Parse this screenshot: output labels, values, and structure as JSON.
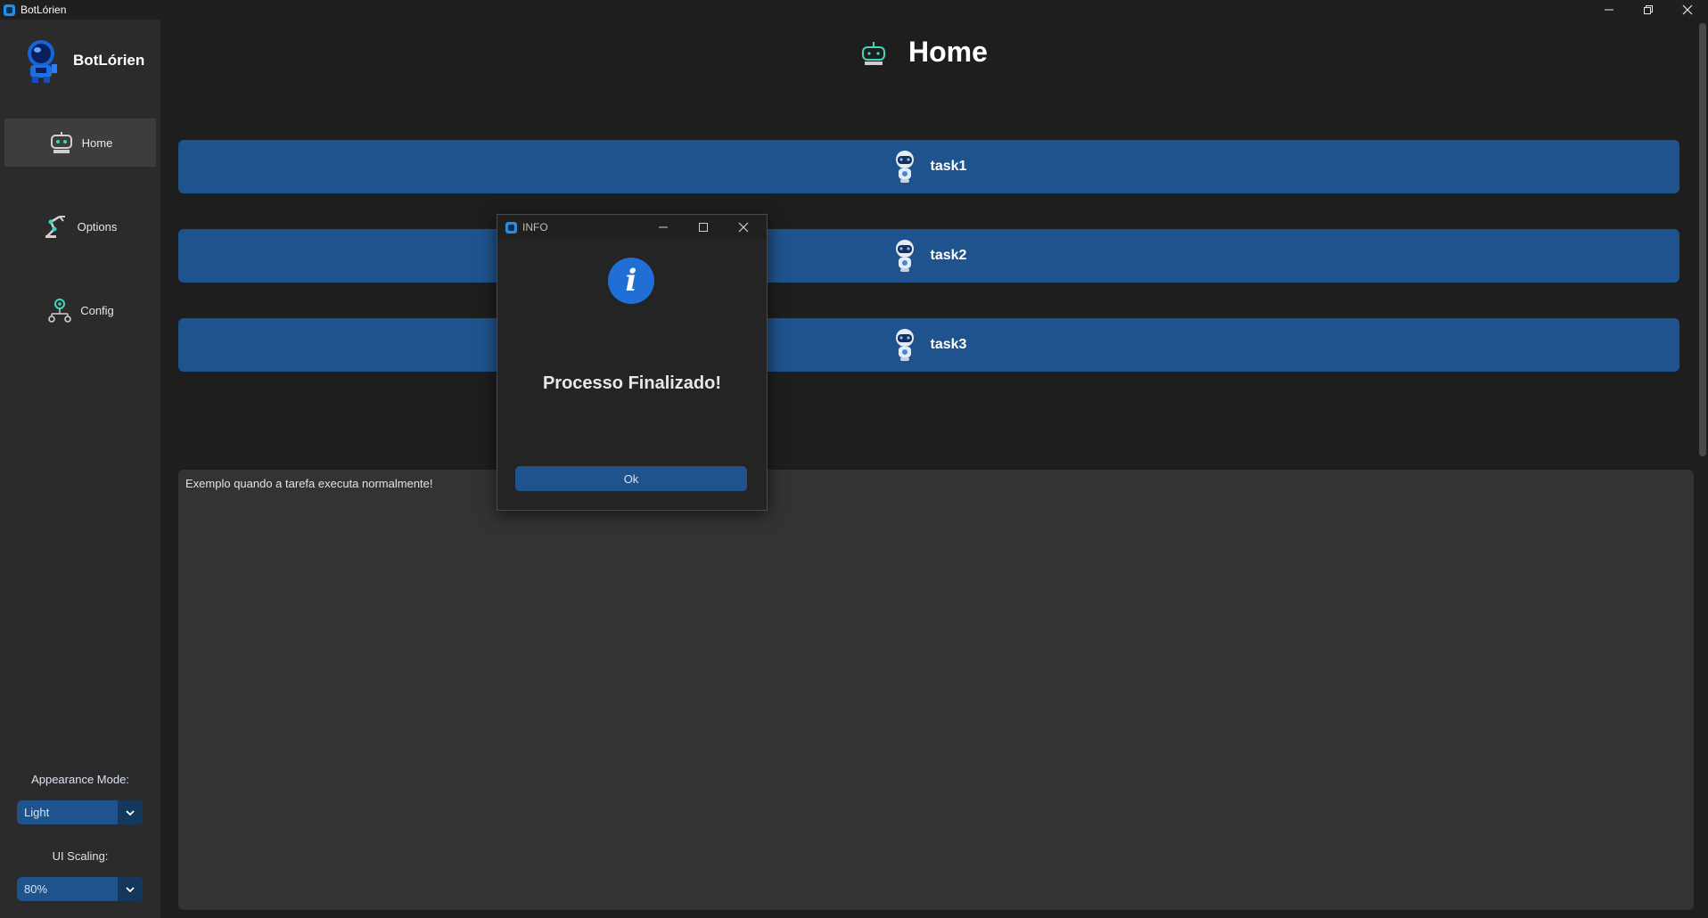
{
  "window": {
    "title": "BotLórien"
  },
  "sidebar": {
    "brand": "BotLórien",
    "items": [
      {
        "label": "Home",
        "icon": "robot-head-icon",
        "active": true
      },
      {
        "label": "Options",
        "icon": "robot-arm-icon",
        "active": false
      },
      {
        "label": "Config",
        "icon": "gear-network-icon",
        "active": false
      }
    ],
    "appearance_label": "Appearance Mode:",
    "appearance_value": "Light",
    "scaling_label": "UI Scaling:",
    "scaling_value": "80%"
  },
  "main": {
    "title": "Home",
    "tasks": [
      {
        "label": "task1"
      },
      {
        "label": "task2"
      },
      {
        "label": "task3"
      }
    ],
    "log_text": "Exemplo quando a tarefa executa normalmente!"
  },
  "dialog": {
    "title": "INFO",
    "message": "Processo Finalizado!",
    "ok_label": "Ok"
  },
  "colors": {
    "background": "#1e1e1e",
    "sidebar": "#2b2b2b",
    "accent": "#1f538d",
    "textbox": "#333333"
  }
}
